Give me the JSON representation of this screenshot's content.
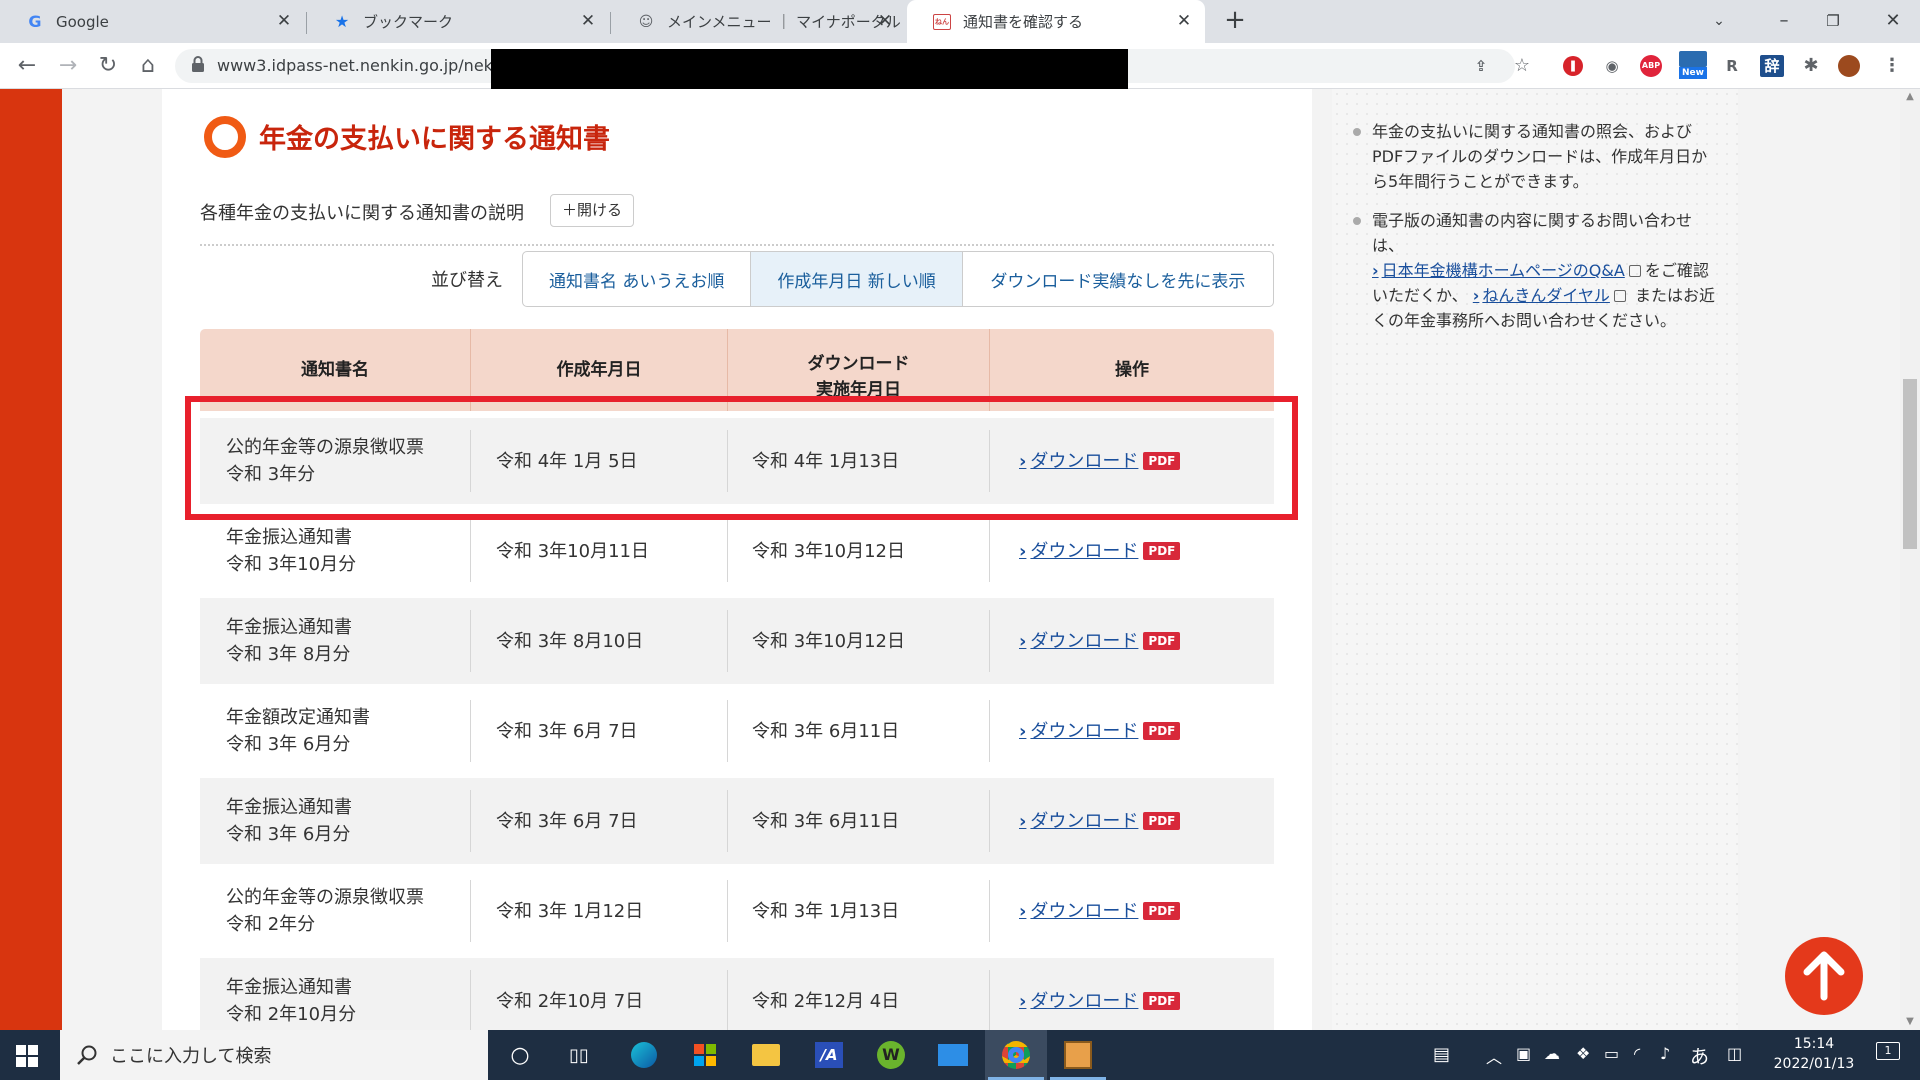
{
  "browser": {
    "tabs": [
      {
        "title": "Google",
        "icon": "google-icon"
      },
      {
        "title": "ブックマーク",
        "icon": "star-icon"
      },
      {
        "title": "メインメニュー ｜ マイナポータル",
        "icon": "portal-icon"
      },
      {
        "title": "通知書を確認する",
        "icon": "nenkin-icon"
      }
    ],
    "address_url": "www3.idpass-net.nenkin.go.jp/neko",
    "extension_badge": "New",
    "abp_label": "ABP"
  },
  "page": {
    "heading": "年金の支払いに関する通知書",
    "description": "各種年金の支払いに関する通知書の説明",
    "open_button": "＋開ける",
    "sort_label": "並び替え",
    "sort_options": [
      {
        "label": "通知書名 あいうえお順",
        "active": false
      },
      {
        "label": "作成年月日 新しい順",
        "active": true
      },
      {
        "label": "ダウンロード実績なしを先に表示",
        "active": false
      }
    ],
    "table": {
      "headers": [
        "通知書名",
        "作成年月日",
        "ダウンロード\n実施年月日",
        "操作"
      ],
      "download_label": "ダウンロード",
      "pdf_label": "PDF",
      "rows": [
        {
          "name": "公的年金等の源泉徴収票",
          "period": "令和 3年分",
          "created": "令和 4年 1月 5日",
          "downloaded": "令和 4年 1月13日"
        },
        {
          "name": "年金振込通知書",
          "period": "令和 3年10月分",
          "created": "令和 3年10月11日",
          "downloaded": "令和 3年10月12日"
        },
        {
          "name": "年金振込通知書",
          "period": "令和 3年 8月分",
          "created": "令和 3年 8月10日",
          "downloaded": "令和 3年10月12日"
        },
        {
          "name": "年金額改定通知書",
          "period": "令和 3年 6月分",
          "created": "令和 3年 6月 7日",
          "downloaded": "令和 3年 6月11日"
        },
        {
          "name": "年金振込通知書",
          "period": "令和 3年 6月分",
          "created": "令和 3年 6月 7日",
          "downloaded": "令和 3年 6月11日"
        },
        {
          "name": "公的年金等の源泉徴収票",
          "period": "令和 2年分",
          "created": "令和 3年 1月12日",
          "downloaded": "令和 3年 1月13日"
        },
        {
          "name": "年金振込通知書",
          "period": "令和 2年10月分",
          "created": "令和 2年10月 7日",
          "downloaded": "令和 2年12月 4日"
        }
      ]
    }
  },
  "sidebar": {
    "note1": "年金の支払いに関する通知書の照会、およびPDFファイルのダウンロードは、作成年月日から5年間行うことができます。",
    "note2_a": "電子版の通知書の内容に関するお問い合わせは、",
    "link_qa": "日本年金機構ホームページのQ&A",
    "note2_b": "をご確認いただくか、",
    "link_dial": "ねんきんダイヤル",
    "note2_c": "またはお近くの年金事務所へお問い合わせください。"
  },
  "taskbar": {
    "search_placeholder": "ここに入力して検索",
    "ime": "あ",
    "time": "15:14",
    "date": "2022/01/13",
    "notification_count": "1"
  },
  "colors": {
    "accent_red": "#d8350f",
    "heading_red": "#c8250c",
    "highlight": "#e8202c",
    "link": "#1a4f9c",
    "table_header": "#f4d7cb"
  }
}
